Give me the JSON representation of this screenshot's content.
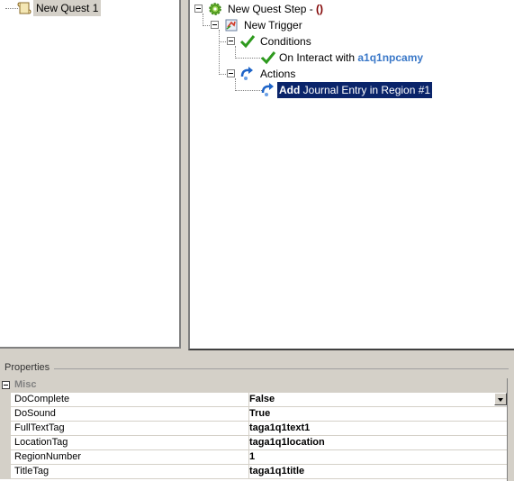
{
  "left_tree": {
    "quest_label": "New Quest 1"
  },
  "right_tree": {
    "step_label": "New Quest Step - ",
    "step_suffix": "()",
    "trigger_label": "New Trigger",
    "conditions_label": "Conditions",
    "condition_item_prefix": "On Interact with ",
    "condition_item_target": "a1q1npcamy",
    "actions_label": "Actions",
    "action_item_verb": "Add",
    "action_item_rest": " Journal Entry in Region #1"
  },
  "properties": {
    "title": "Properties",
    "category": "Misc",
    "rows": [
      {
        "name": "DoComplete",
        "value": "False"
      },
      {
        "name": "DoSound",
        "value": "True"
      },
      {
        "name": "FullTextTag",
        "value": "taga1q1text1"
      },
      {
        "name": "LocationTag",
        "value": "taga1q1location"
      },
      {
        "name": "RegionNumber",
        "value": "1"
      },
      {
        "name": "TitleTag",
        "value": "taga1q1title"
      }
    ]
  }
}
